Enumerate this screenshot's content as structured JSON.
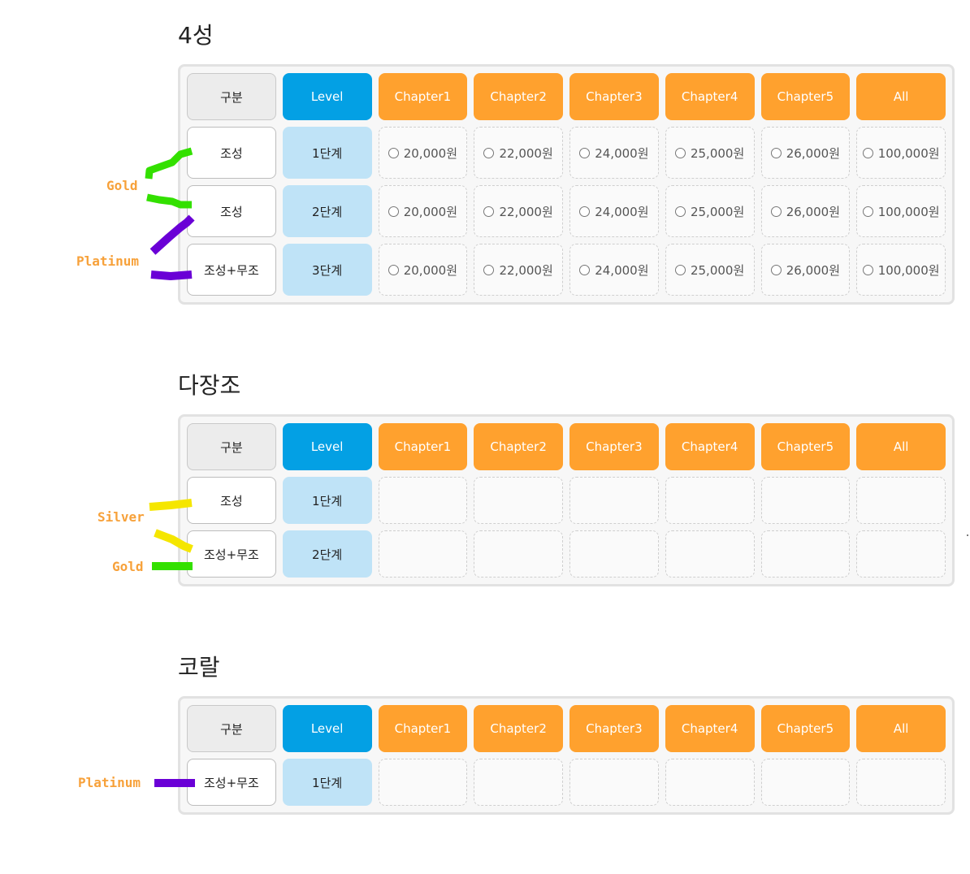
{
  "columns": {
    "category": "구분",
    "level": "Level",
    "chapters": [
      "Chapter1",
      "Chapter2",
      "Chapter3",
      "Chapter4",
      "Chapter5"
    ],
    "all": "All"
  },
  "sections": [
    {
      "title": "4성",
      "rows": [
        {
          "category": "조성",
          "level": "1단계",
          "prices": [
            "20,000원",
            "22,000원",
            "24,000원",
            "25,000원",
            "26,000원",
            "100,000원"
          ]
        },
        {
          "category": "조성",
          "level": "2단계",
          "prices": [
            "20,000원",
            "22,000원",
            "24,000원",
            "25,000원",
            "26,000원",
            "100,000원"
          ]
        },
        {
          "category": "조성+무조",
          "level": "3단계",
          "prices": [
            "20,000원",
            "22,000원",
            "24,000원",
            "25,000원",
            "26,000원",
            "100,000원"
          ]
        }
      ]
    },
    {
      "title": "다장조",
      "rows": [
        {
          "category": "조성",
          "level": "1단계",
          "prices": []
        },
        {
          "category": "조성+무조",
          "level": "2단계",
          "prices": []
        }
      ]
    },
    {
      "title": "코랄",
      "rows": [
        {
          "category": "조성+무조",
          "level": "1단계",
          "prices": []
        }
      ]
    }
  ],
  "annotations": {
    "gold_1": "Gold",
    "platinum_1": "Platinum",
    "silver": "Silver",
    "gold_2": "Gold",
    "platinum_2": "Platinum"
  },
  "colors": {
    "level_header": "#03a0e4",
    "chapter_header": "#ffa12e",
    "level_cell": "#bfe3f7",
    "annotation_text": "#f7a13a",
    "gold_marker": "#33e000",
    "platinum_marker": "#6a00d6",
    "silver_marker": "#f5e600"
  }
}
